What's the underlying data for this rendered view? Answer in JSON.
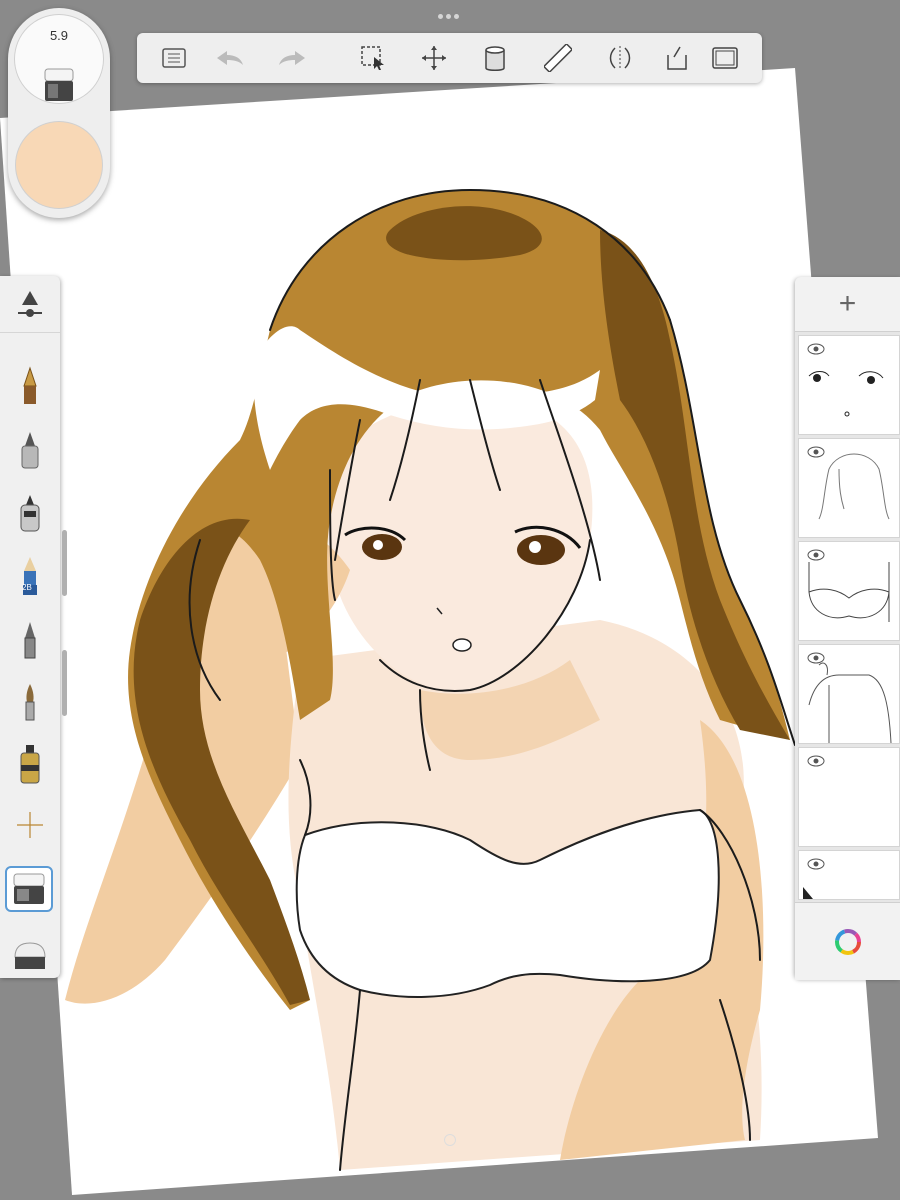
{
  "app": {
    "brush_size": "5.9",
    "current_color": "#f8d8b6"
  },
  "toolbar": {
    "items": [
      "list-icon",
      "undo-icon",
      "redo-icon",
      "selection-icon",
      "transform-icon",
      "fill-bucket-icon",
      "ruler-icon",
      "symmetry-icon",
      "perspective-icon",
      "fullscreen-icon"
    ]
  },
  "brushes": {
    "items": [
      "brush-settings-icon",
      "pen-nib-icon",
      "marker-icon",
      "airbrush-icon",
      "pencil-2b-icon",
      "ink-pen-icon",
      "paintbrush-icon",
      "bottle-brush-icon",
      "smudge-icon",
      "eraser-icon",
      "soft-eraser-icon"
    ],
    "pencil_label": "2B",
    "selected": "eraser-icon"
  },
  "layers": {
    "add_label": "+",
    "items": [
      {
        "name": "face-layer",
        "visible": true
      },
      {
        "name": "hair-sketch-layer",
        "visible": true
      },
      {
        "name": "bra-sketch-layer",
        "visible": true
      },
      {
        "name": "body-sketch-layer",
        "visible": true
      },
      {
        "name": "empty-layer",
        "visible": true
      },
      {
        "name": "partial-layer",
        "visible": true
      }
    ]
  },
  "colors": {
    "hair": "#b98632",
    "hair_shadow": "#7a5218",
    "skin": "#f9e6d6",
    "skin_shadow": "#f1cda3",
    "background": "#8a8a8a"
  }
}
